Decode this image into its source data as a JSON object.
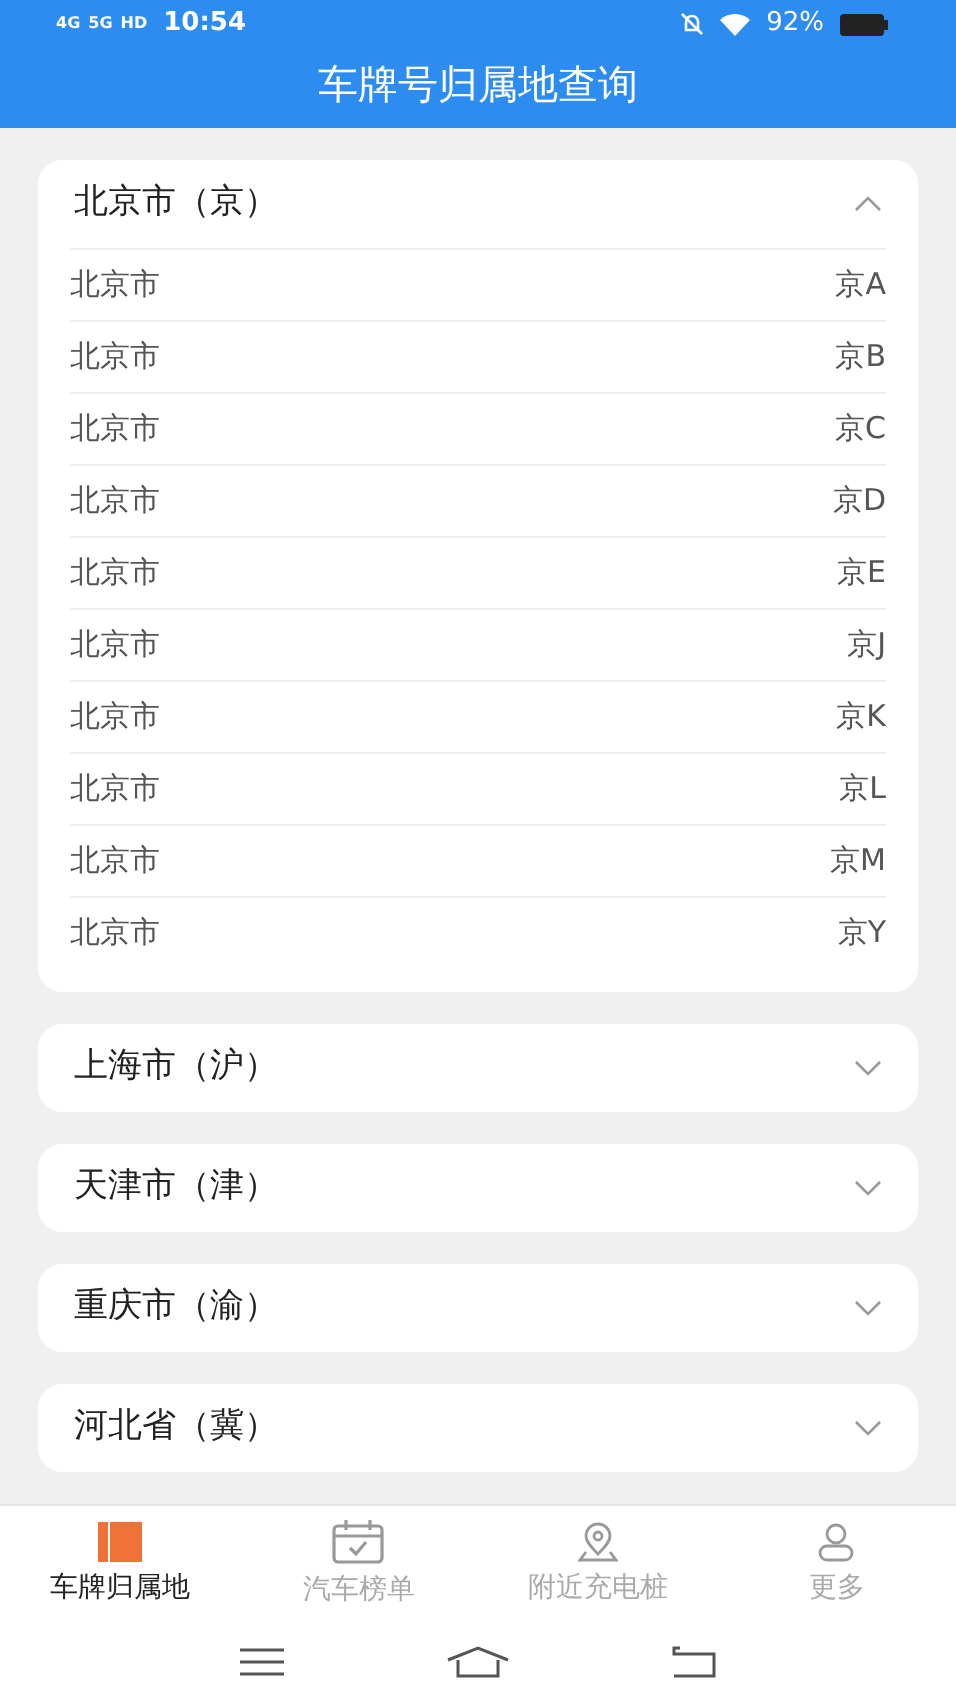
{
  "status_bar": {
    "network_labels": [
      "4G",
      "5G",
      "HD"
    ],
    "time": "10:54",
    "battery": "92%"
  },
  "title": "车牌号归属地查询",
  "provinces": [
    {
      "name": "北京市（京）",
      "expanded": true,
      "plates": [
        {
          "city": "北京市",
          "code": "京A"
        },
        {
          "city": "北京市",
          "code": "京B"
        },
        {
          "city": "北京市",
          "code": "京C"
        },
        {
          "city": "北京市",
          "code": "京D"
        },
        {
          "city": "北京市",
          "code": "京E"
        },
        {
          "city": "北京市",
          "code": "京J"
        },
        {
          "city": "北京市",
          "code": "京K"
        },
        {
          "city": "北京市",
          "code": "京L"
        },
        {
          "city": "北京市",
          "code": "京M"
        },
        {
          "city": "北京市",
          "code": "京Y"
        }
      ]
    },
    {
      "name": "上海市（沪）",
      "expanded": false
    },
    {
      "name": "天津市（津）",
      "expanded": false
    },
    {
      "name": "重庆市（渝）",
      "expanded": false
    },
    {
      "name": "河北省（冀）",
      "expanded": false
    }
  ],
  "tabs": [
    {
      "label": "车牌归属地",
      "kind": "book",
      "selected": true
    },
    {
      "label": "汽车榜单",
      "kind": "calendar",
      "selected": false
    },
    {
      "label": "附近充电桩",
      "kind": "pin",
      "selected": false
    },
    {
      "label": "更多",
      "kind": "person",
      "selected": false
    }
  ]
}
